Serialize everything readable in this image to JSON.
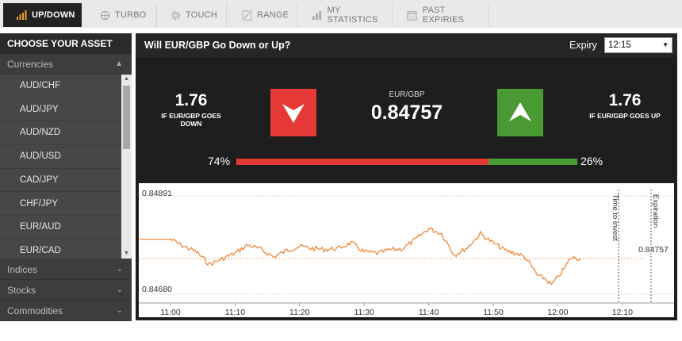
{
  "tabs": [
    {
      "label": "UP/DOWN",
      "icon": "bar-chart-icon",
      "active": true
    },
    {
      "label": "TURBO",
      "icon": "globe-icon",
      "active": false
    },
    {
      "label": "TOUCH",
      "icon": "gear-icon",
      "active": false
    },
    {
      "label": "RANGE",
      "icon": "range-icon",
      "active": false
    },
    {
      "label": "MY STATISTICS",
      "icon": "statistics-icon",
      "active": false
    },
    {
      "label": "PAST EXPIRIES",
      "icon": "calendar-icon",
      "active": false
    }
  ],
  "sidebar": {
    "title": "CHOOSE YOUR ASSET",
    "currencies_label": "Currencies",
    "assets": [
      "AUD/CHF",
      "AUD/JPY",
      "AUD/NZD",
      "AUD/USD",
      "CAD/JPY",
      "CHF/JPY",
      "EUR/AUD",
      "EUR/CAD"
    ],
    "categories": [
      "Indices",
      "Stocks",
      "Commodities"
    ]
  },
  "main": {
    "question": "Will EUR/GBP Go Down or Up?",
    "expiry_label": "Expiry",
    "expiry_value": "12:15",
    "down": {
      "payout": "1.76",
      "label_line1": "IF EUR/GBP GOES",
      "label_line2": "DOWN"
    },
    "up": {
      "payout": "1.76",
      "label_line1": "IF EUR/GBP GOES UP"
    },
    "pair": "EUR/GBP",
    "price": "0.84757",
    "down_pct_label": "74%",
    "up_pct_label": "26%",
    "down_pct": 74,
    "up_pct": 26
  },
  "colors": {
    "down": "#e53935",
    "up": "#4a9a33",
    "line": "#f07d28",
    "accent": "#f0a030"
  },
  "chart_data": {
    "type": "line",
    "xlabels": [
      "11:00",
      "11:10",
      "11:20",
      "11:30",
      "11:40",
      "11:50",
      "12:00",
      "12:10"
    ],
    "y_top_label": "0.84891",
    "y_bottom_label": "0.84680",
    "current_label": "0.84757",
    "ylim": [
      0.8468,
      0.84891
    ],
    "time_to_invest_label": "Time to invest",
    "expiration_label": "Expiration",
    "x_minutes": [
      0,
      2,
      4,
      6,
      8,
      10,
      12,
      14,
      16,
      18,
      20,
      22,
      24,
      26,
      28,
      30,
      32,
      34,
      36,
      38,
      40,
      42,
      44,
      46,
      48,
      50,
      52,
      54,
      55,
      56,
      57,
      58,
      59,
      60,
      61,
      62,
      63.5
    ],
    "values": [
      0.84798,
      0.84783,
      0.84771,
      0.84744,
      0.84756,
      0.84768,
      0.84786,
      0.84776,
      0.8476,
      0.84774,
      0.84783,
      0.84778,
      0.84776,
      0.84778,
      0.8479,
      0.84771,
      0.84768,
      0.84775,
      0.84778,
      0.84798,
      0.84821,
      0.8481,
      0.84764,
      0.8478,
      0.8481,
      0.8479,
      0.84773,
      0.84766,
      0.84758,
      0.84738,
      0.84718,
      0.84714,
      0.847,
      0.84716,
      0.84735,
      0.84758,
      0.84757
    ]
  }
}
